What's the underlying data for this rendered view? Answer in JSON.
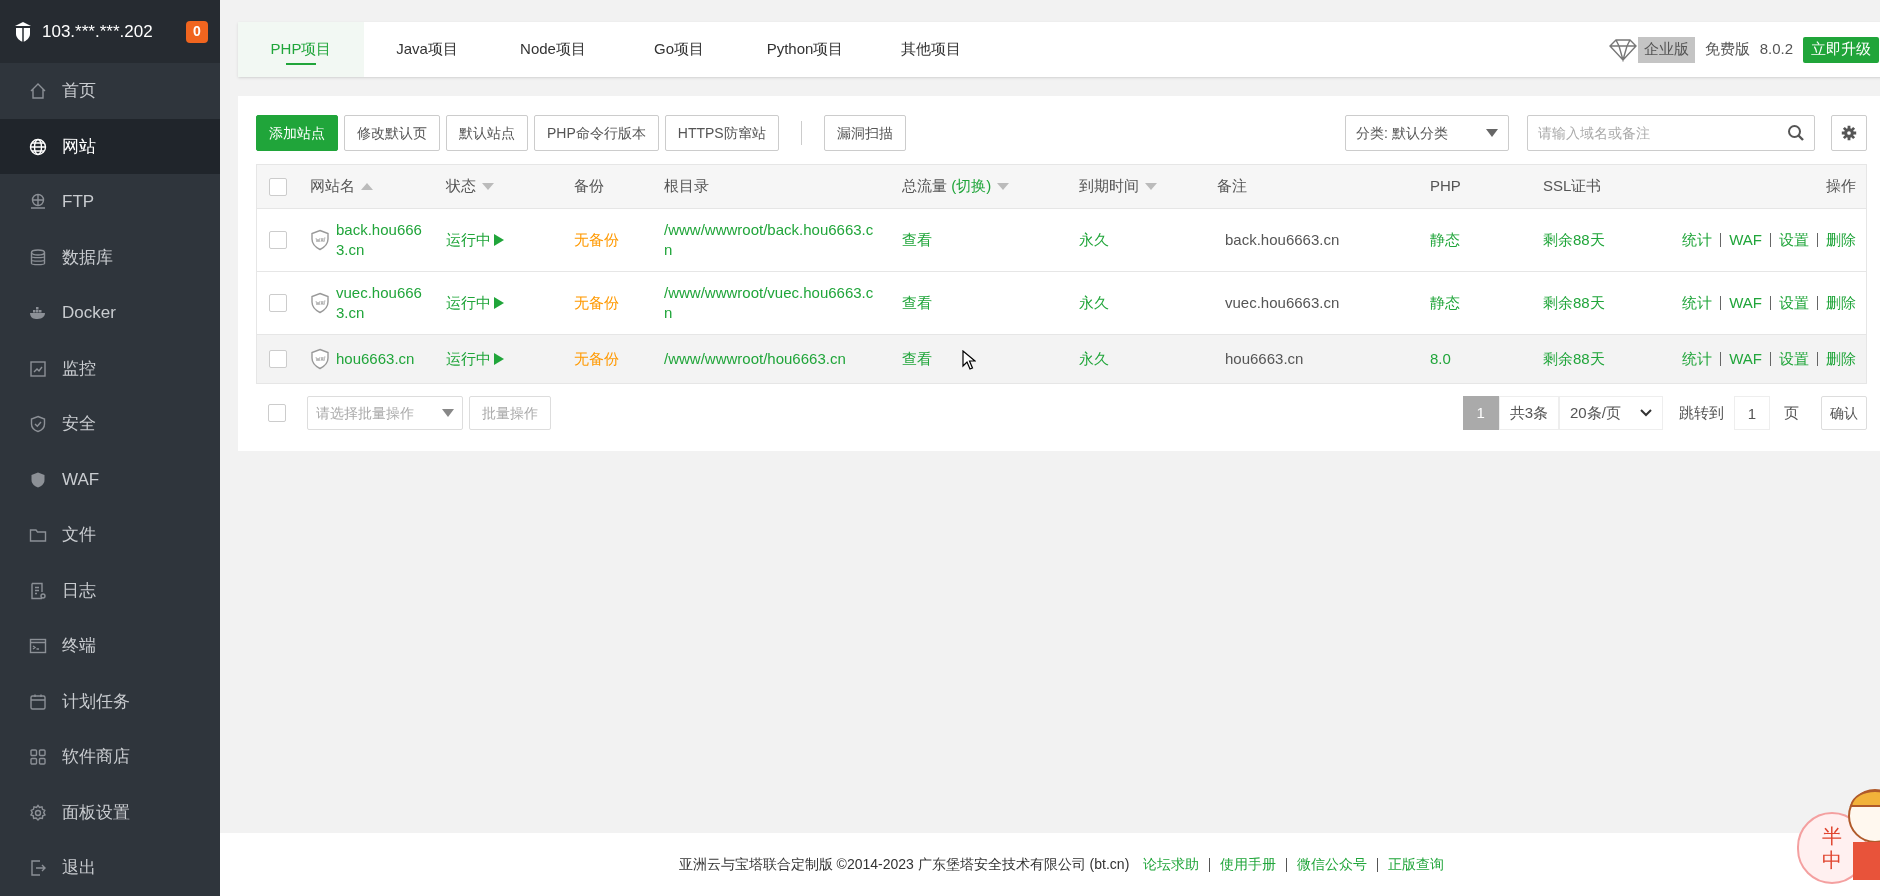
{
  "sidebar": {
    "server": "103.***.***.202",
    "badge": "0",
    "items": [
      {
        "label": "首页",
        "selected": false
      },
      {
        "label": "网站",
        "selected": true
      },
      {
        "label": "FTP",
        "selected": false
      },
      {
        "label": "数据库",
        "selected": false
      },
      {
        "label": "Docker",
        "selected": false
      },
      {
        "label": "监控",
        "selected": false
      },
      {
        "label": "安全",
        "selected": false
      },
      {
        "label": "WAF",
        "selected": false
      },
      {
        "label": "文件",
        "selected": false
      },
      {
        "label": "日志",
        "selected": false
      },
      {
        "label": "终端",
        "selected": false
      },
      {
        "label": "计划任务",
        "selected": false
      },
      {
        "label": "软件商店",
        "selected": false
      },
      {
        "label": "面板设置",
        "selected": false
      },
      {
        "label": "退出",
        "selected": false
      }
    ]
  },
  "tabs": [
    {
      "label": "PHP项目",
      "selected": true
    },
    {
      "label": "Java项目",
      "selected": false
    },
    {
      "label": "Node项目",
      "selected": false
    },
    {
      "label": "Go项目",
      "selected": false
    },
    {
      "label": "Python项目",
      "selected": false
    },
    {
      "label": "其他项目",
      "selected": false
    }
  ],
  "header_right": {
    "edition": "企业版",
    "plan": "免费版",
    "version": "8.0.2",
    "upgrade": "立即升级"
  },
  "toolbar": {
    "buttons": [
      {
        "label": "添加站点",
        "kind": "primary"
      },
      {
        "label": "修改默认页",
        "kind": "default"
      },
      {
        "label": "默认站点",
        "kind": "default"
      },
      {
        "label": "PHP命令行版本",
        "kind": "default"
      },
      {
        "label": "HTTPS防窜站",
        "kind": "default"
      }
    ],
    "extra_buttons": [
      {
        "label": "漏洞扫描",
        "kind": "default"
      }
    ],
    "category_select": "分类: 默认分类",
    "search_placeholder": "请输入域名或备注"
  },
  "table": {
    "select_all_checked": false,
    "columns": [
      {
        "label": "网站名",
        "kind": "ascending"
      },
      {
        "label": "状态",
        "kind": "descending"
      },
      {
        "label": "备份",
        "kind": "plain"
      },
      {
        "label": "根目录",
        "kind": "plain"
      },
      {
        "label": "总流量",
        "toggle": "(切换)",
        "kind": "descending"
      },
      {
        "label": "到期时间",
        "kind": "descending"
      },
      {
        "label": "备注",
        "kind": "plain"
      },
      {
        "label": "PHP",
        "kind": "plain"
      },
      {
        "label": "SSL证书",
        "kind": "plain"
      },
      {
        "label": "操作",
        "kind": "plain"
      }
    ],
    "rows": [
      {
        "checked": false,
        "hovered": false,
        "site": "back.hou6663.cn",
        "status": "运行中",
        "running": true,
        "backup": "无备份",
        "root": "/www/wwwroot/back.hou6663.cn",
        "traffic": "查看",
        "expiry": "永久",
        "note": "back.hou6663.cn",
        "php": "静态",
        "ssl": "剩余88天",
        "actions": [
          "统计",
          "WAF",
          "设置",
          "删除"
        ]
      },
      {
        "checked": false,
        "hovered": false,
        "site": "vuec.hou6663.cn",
        "status": "运行中",
        "running": true,
        "backup": "无备份",
        "root": "/www/wwwroot/vuec.hou6663.cn",
        "traffic": "查看",
        "expiry": "永久",
        "note": "vuec.hou6663.cn",
        "php": "静态",
        "ssl": "剩余88天",
        "actions": [
          "统计",
          "WAF",
          "设置",
          "删除"
        ]
      },
      {
        "checked": false,
        "hovered": true,
        "site": "hou6663.cn",
        "status": "运行中",
        "running": true,
        "backup": "无备份",
        "root": "/www/wwwroot/hou6663.cn",
        "traffic": "查看",
        "expiry": "永久",
        "note": "hou6663.cn",
        "php": "8.0",
        "ssl": "剩余88天",
        "actions": [
          "统计",
          "WAF",
          "设置",
          "删除"
        ]
      }
    ]
  },
  "bulk": {
    "checked": false,
    "select_placeholder": "请选择批量操作",
    "button": "批量操作"
  },
  "pagination": {
    "pages": [
      {
        "label": "1",
        "selected": true
      }
    ],
    "total": "共3条",
    "per_page": "20条/页",
    "jump_label": "跳转到",
    "jump_value": "1",
    "page_unit": "页",
    "confirm": "确认"
  },
  "footer": {
    "text": "亚洲云与宝塔联合定制版 ©2014-2023 广东堡塔安全技术有限公司 (bt.cn)",
    "links": [
      "论坛求助",
      "使用手册",
      "微信公众号",
      "正版查询"
    ]
  },
  "widget": {
    "texts": [
      "半",
      "中"
    ]
  }
}
